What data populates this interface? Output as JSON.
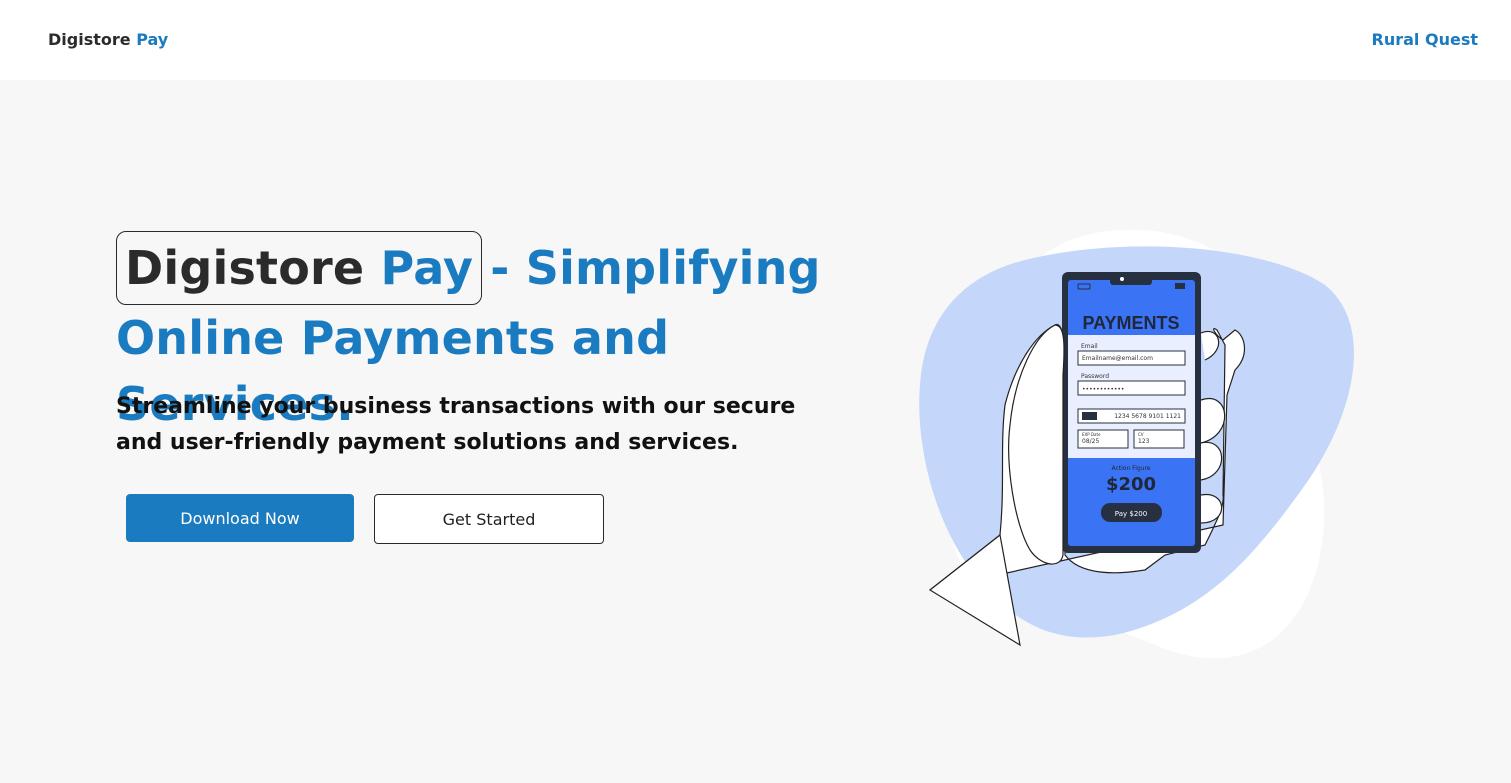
{
  "navbar": {
    "brand_main": "Digistore",
    "brand_accent": "Pay",
    "link": "Rural Quest"
  },
  "hero": {
    "headline_brand_dark": "Digistore",
    "headline_brand_blue": "Pay",
    "headline_rest": "- Simplifying Online Payments and Services.",
    "subtext": "Streamline your business transactions with our secure and user-friendly payment solutions and services.",
    "primary_button": "Download Now",
    "secondary_button": "Get Started"
  },
  "phone": {
    "title": "PAYMENTS",
    "email_label": "Email",
    "email_value": "Emailname@email.com",
    "password_label": "Password",
    "password_value": "••••••••••••",
    "card_number": "1234 5678 9101 1121",
    "exp_label": "EXP Date",
    "exp_value": "08/25",
    "cvv_label": "CV",
    "cvv_value": "123",
    "amount_label": "Action Figure",
    "amount": "$200",
    "pay_button": "Pay $200"
  },
  "colors": {
    "accent": "#1b7bc0",
    "phone_screen": "#3b73f5",
    "blob": "#c5d6fb"
  }
}
